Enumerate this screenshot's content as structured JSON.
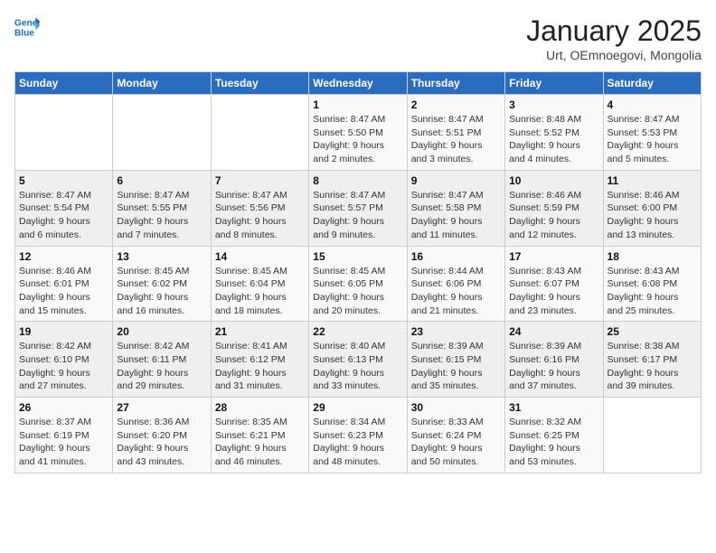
{
  "header": {
    "logo_line1": "General",
    "logo_line2": "Blue",
    "month_title": "January 2025",
    "location": "Urt, OEmnoegovi, Mongolia"
  },
  "weekdays": [
    "Sunday",
    "Monday",
    "Tuesday",
    "Wednesday",
    "Thursday",
    "Friday",
    "Saturday"
  ],
  "weeks": [
    [
      {
        "day": "",
        "info": ""
      },
      {
        "day": "",
        "info": ""
      },
      {
        "day": "",
        "info": ""
      },
      {
        "day": "1",
        "info": "Sunrise: 8:47 AM\nSunset: 5:50 PM\nDaylight: 9 hours\nand 2 minutes."
      },
      {
        "day": "2",
        "info": "Sunrise: 8:47 AM\nSunset: 5:51 PM\nDaylight: 9 hours\nand 3 minutes."
      },
      {
        "day": "3",
        "info": "Sunrise: 8:48 AM\nSunset: 5:52 PM\nDaylight: 9 hours\nand 4 minutes."
      },
      {
        "day": "4",
        "info": "Sunrise: 8:47 AM\nSunset: 5:53 PM\nDaylight: 9 hours\nand 5 minutes."
      }
    ],
    [
      {
        "day": "5",
        "info": "Sunrise: 8:47 AM\nSunset: 5:54 PM\nDaylight: 9 hours\nand 6 minutes."
      },
      {
        "day": "6",
        "info": "Sunrise: 8:47 AM\nSunset: 5:55 PM\nDaylight: 9 hours\nand 7 minutes."
      },
      {
        "day": "7",
        "info": "Sunrise: 8:47 AM\nSunset: 5:56 PM\nDaylight: 9 hours\nand 8 minutes."
      },
      {
        "day": "8",
        "info": "Sunrise: 8:47 AM\nSunset: 5:57 PM\nDaylight: 9 hours\nand 9 minutes."
      },
      {
        "day": "9",
        "info": "Sunrise: 8:47 AM\nSunset: 5:58 PM\nDaylight: 9 hours\nand 11 minutes."
      },
      {
        "day": "10",
        "info": "Sunrise: 8:46 AM\nSunset: 5:59 PM\nDaylight: 9 hours\nand 12 minutes."
      },
      {
        "day": "11",
        "info": "Sunrise: 8:46 AM\nSunset: 6:00 PM\nDaylight: 9 hours\nand 13 minutes."
      }
    ],
    [
      {
        "day": "12",
        "info": "Sunrise: 8:46 AM\nSunset: 6:01 PM\nDaylight: 9 hours\nand 15 minutes."
      },
      {
        "day": "13",
        "info": "Sunrise: 8:45 AM\nSunset: 6:02 PM\nDaylight: 9 hours\nand 16 minutes."
      },
      {
        "day": "14",
        "info": "Sunrise: 8:45 AM\nSunset: 6:04 PM\nDaylight: 9 hours\nand 18 minutes."
      },
      {
        "day": "15",
        "info": "Sunrise: 8:45 AM\nSunset: 6:05 PM\nDaylight: 9 hours\nand 20 minutes."
      },
      {
        "day": "16",
        "info": "Sunrise: 8:44 AM\nSunset: 6:06 PM\nDaylight: 9 hours\nand 21 minutes."
      },
      {
        "day": "17",
        "info": "Sunrise: 8:43 AM\nSunset: 6:07 PM\nDaylight: 9 hours\nand 23 minutes."
      },
      {
        "day": "18",
        "info": "Sunrise: 8:43 AM\nSunset: 6:08 PM\nDaylight: 9 hours\nand 25 minutes."
      }
    ],
    [
      {
        "day": "19",
        "info": "Sunrise: 8:42 AM\nSunset: 6:10 PM\nDaylight: 9 hours\nand 27 minutes."
      },
      {
        "day": "20",
        "info": "Sunrise: 8:42 AM\nSunset: 6:11 PM\nDaylight: 9 hours\nand 29 minutes."
      },
      {
        "day": "21",
        "info": "Sunrise: 8:41 AM\nSunset: 6:12 PM\nDaylight: 9 hours\nand 31 minutes."
      },
      {
        "day": "22",
        "info": "Sunrise: 8:40 AM\nSunset: 6:13 PM\nDaylight: 9 hours\nand 33 minutes."
      },
      {
        "day": "23",
        "info": "Sunrise: 8:39 AM\nSunset: 6:15 PM\nDaylight: 9 hours\nand 35 minutes."
      },
      {
        "day": "24",
        "info": "Sunrise: 8:39 AM\nSunset: 6:16 PM\nDaylight: 9 hours\nand 37 minutes."
      },
      {
        "day": "25",
        "info": "Sunrise: 8:38 AM\nSunset: 6:17 PM\nDaylight: 9 hours\nand 39 minutes."
      }
    ],
    [
      {
        "day": "26",
        "info": "Sunrise: 8:37 AM\nSunset: 6:19 PM\nDaylight: 9 hours\nand 41 minutes."
      },
      {
        "day": "27",
        "info": "Sunrise: 8:36 AM\nSunset: 6:20 PM\nDaylight: 9 hours\nand 43 minutes."
      },
      {
        "day": "28",
        "info": "Sunrise: 8:35 AM\nSunset: 6:21 PM\nDaylight: 9 hours\nand 46 minutes."
      },
      {
        "day": "29",
        "info": "Sunrise: 8:34 AM\nSunset: 6:23 PM\nDaylight: 9 hours\nand 48 minutes."
      },
      {
        "day": "30",
        "info": "Sunrise: 8:33 AM\nSunset: 6:24 PM\nDaylight: 9 hours\nand 50 minutes."
      },
      {
        "day": "31",
        "info": "Sunrise: 8:32 AM\nSunset: 6:25 PM\nDaylight: 9 hours\nand 53 minutes."
      },
      {
        "day": "",
        "info": ""
      }
    ]
  ]
}
